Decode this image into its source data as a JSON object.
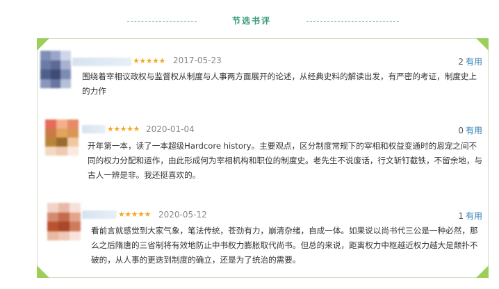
{
  "section": {
    "title": "节选书评"
  },
  "colors": {
    "accent": "#3a9a7e",
    "star": "#f5a623",
    "link": "#2f7fb5",
    "corner": "#9ccf5a"
  },
  "reviews": [
    {
      "rating": 5,
      "stars": "★★★★★",
      "date": "2017-05-23",
      "helpful_count": "2",
      "helpful_label": "有用",
      "text": "围绕着宰相议政权与监督权从制度与人事两方面展开的论述，从经典史料的解读出发，有严密的考证，制度史上的力作"
    },
    {
      "rating": 5,
      "stars": "★★★★★",
      "date": "2020-01-04",
      "helpful_count": "0",
      "helpful_label": "有用",
      "text": "开年第一本，读了一本超级Hardcore history。主要观点，区分制度常规下的宰相和权益变通时的恩宠之间不同的权力分配和运作，由此形成何为宰相机构和职位的制度史。老先生不说废话，行文斩钉截铁，不留余地，与古人一辨是非。我还挺喜欢的。"
    },
    {
      "rating": 5,
      "stars": "★★★★★",
      "date": "2020-05-12",
      "helpful_count": "1",
      "helpful_label": "有用",
      "text": "看前言就感觉到大家气象，笔法传统，苍劲有力，崩清杂绪，自成一体。如果说以尚书代三公是一种必然，那么之后隋唐的三省制将有效地防止中书权力膨胀取代尚书。但总的来说，距离权力中枢越近权力越大是颠扑不破的，从人事的更迭到制度的确立，还是为了统治的需要。"
    }
  ]
}
